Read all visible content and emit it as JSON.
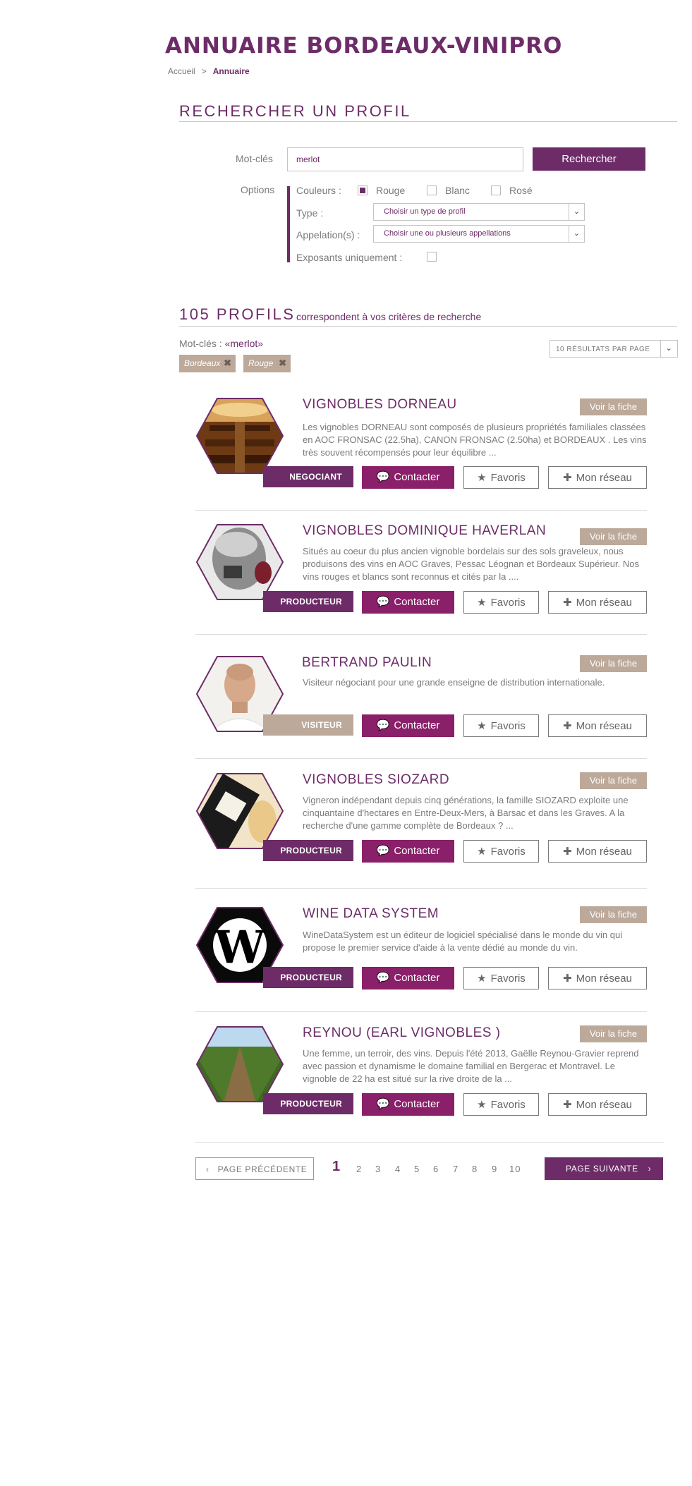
{
  "header": {
    "title": "ANNUAIRE BORDEAUX-VINIPRO",
    "breadcrumb": {
      "home": "Accueil",
      "sep": ">",
      "current": "Annuaire"
    }
  },
  "search": {
    "section_title": "RECHERCHER UN PROFIL",
    "keywords_label": "Mot-clés",
    "keywords_value": "merlot",
    "submit_label": "Rechercher",
    "options_label": "Options",
    "colors_label": "Couleurs :",
    "colors": [
      {
        "label": "Rouge",
        "checked": true
      },
      {
        "label": "Blanc",
        "checked": false
      },
      {
        "label": "Rosé",
        "checked": false
      }
    ],
    "type_label": "Type :",
    "type_value": "Choisir un type de profil",
    "appellation_label": "Appelation(s) :",
    "appellation_value": "Choisir une ou plusieurs appellations",
    "exhibitors_label": "Exposants uniquement :",
    "exhibitors_checked": false
  },
  "results": {
    "count_big": "105 PROFILS",
    "count_small": "correspondent à vos critères de recherche",
    "kw_prefix": "Mot-clés :",
    "kw_value": "«merlot»",
    "per_page": "10 RÉSULTATS PAR PAGE",
    "tags": [
      "Bordeaux",
      "Rouge"
    ]
  },
  "common": {
    "fiche_label": "Voir la fiche",
    "contact_label": "Contacter",
    "fav_label": "Favoris",
    "network_label": "Mon réseau"
  },
  "profiles": [
    {
      "name": "VIGNOBLES DORNEAU",
      "badge": "NEGOCIANT",
      "desc": "Les vignobles DORNEAU sont composés de plusieurs propriétés familiales classées en AOC FRONSAC (22.5ha), CANON FRONSAC (2.50ha) et BORDEAUX . Les vins très souvent récompensés pour leur équilibre ..."
    },
    {
      "name": "VIGNOBLES DOMINIQUE HAVERLAN",
      "badge": "PRODUCTEUR",
      "desc": "Situés au coeur du plus ancien vignoble bordelais sur des sols graveleux, nous produisons des vins en AOC Graves, Pessac Léognan et Bordeaux Supérieur. Nos vins rouges et blancs sont reconnus et cités par la ...."
    },
    {
      "name": "BERTRAND PAULIN",
      "badge": "VISITEUR",
      "desc": "Visiteur négociant pour une grande enseigne de distribution internationale."
    },
    {
      "name": "VIGNOBLES SIOZARD",
      "badge": "PRODUCTEUR",
      "desc": "Vigneron indépendant depuis cinq générations, la famille SIOZARD exploite une cinquantaine d'hectares en Entre-Deux-Mers, à Barsac et dans les Graves. A la recherche d'une gamme complète de Bordeaux ? ..."
    },
    {
      "name": "WINE DATA SYSTEM",
      "badge": "PRODUCTEUR",
      "desc": "WineDataSystem est un éditeur de logiciel spécialisé dans le monde du vin qui propose le premier service d'aide à la vente dédié au monde du vin."
    },
    {
      "name": "REYNOU (EARL VIGNOBLES )",
      "badge": "PRODUCTEUR",
      "desc": "Une femme, un terroir, des vins. Depuis l'été 2013, Gaëlle Reynou-Gravier reprend avec passion et dynamisme le domaine familial en Bergerac et Montravel. Le vignoble de 22 ha est situé sur la rive droite de la ..."
    }
  ],
  "pagination": {
    "prev": "PAGE PRÉCÉDENTE",
    "next": "PAGE SUIVANTE",
    "pages": [
      "1",
      "2",
      "3",
      "4",
      "5",
      "6",
      "7",
      "8",
      "9",
      "10"
    ],
    "current": "1"
  },
  "colors": {
    "accent": "#6d2c68",
    "contact": "#8a1f6a",
    "beige": "#bca99a"
  },
  "icons": [
    "chat-icon",
    "star-icon",
    "plus-icon",
    "chevron-left-icon",
    "chevron-right-icon",
    "chevron-down-icon",
    "close-icon"
  ]
}
